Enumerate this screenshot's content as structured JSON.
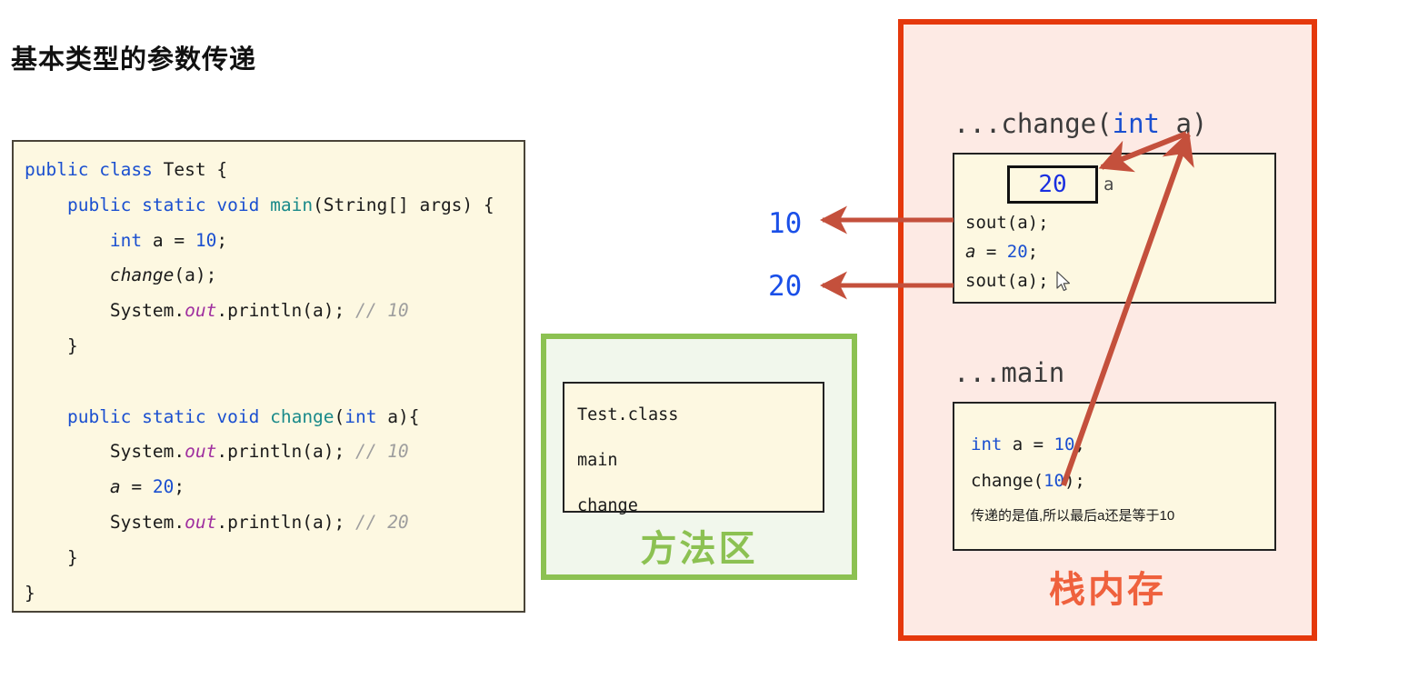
{
  "page": {
    "title": "基本类型的参数传递"
  },
  "code_panel": {
    "lines": [
      "public class Test {",
      "    public static void main(String[] args) {",
      "        int a = 10;",
      "        change(a);",
      "        System.out.println(a); // 10",
      "    }",
      "",
      "    public static void change(int a){",
      "        System.out.println(a); // 10",
      "        a = 20;",
      "        System.out.println(a); // 20",
      "    }",
      "}"
    ]
  },
  "method_area": {
    "label": "方法区",
    "entries": [
      "Test.class",
      "main",
      "change"
    ],
    "border_color": "#8cc152",
    "fill_color": "#f1f7ec"
  },
  "stack_memory": {
    "label": "栈内存",
    "border_color": "#e5380c",
    "fill_color": "#fdeae4",
    "change_frame": {
      "header_prefix": "...change(",
      "header_type": "int",
      "header_suffix": " a)",
      "value_cell": "20",
      "value_name": "a",
      "lines": [
        "sout(a);",
        "a = 20;",
        "sout(a);"
      ],
      "line2_var": "a",
      "line2_mid": " = ",
      "line2_num": "20",
      "line2_end": ";"
    },
    "main_frame": {
      "header": "...main",
      "line1_kw": "int",
      "line1_var": " a = ",
      "line1_num": "10",
      "line1_end": ";",
      "line2_pre": "change(",
      "line2_num": "10",
      "line2_post": ");",
      "note": "传递的是值,所以最后a还是等于10"
    }
  },
  "output_labels": {
    "first": "10",
    "second": "20",
    "color": "#1a4fe8"
  },
  "icons": {
    "cursor": "mouse-pointer-icon"
  }
}
